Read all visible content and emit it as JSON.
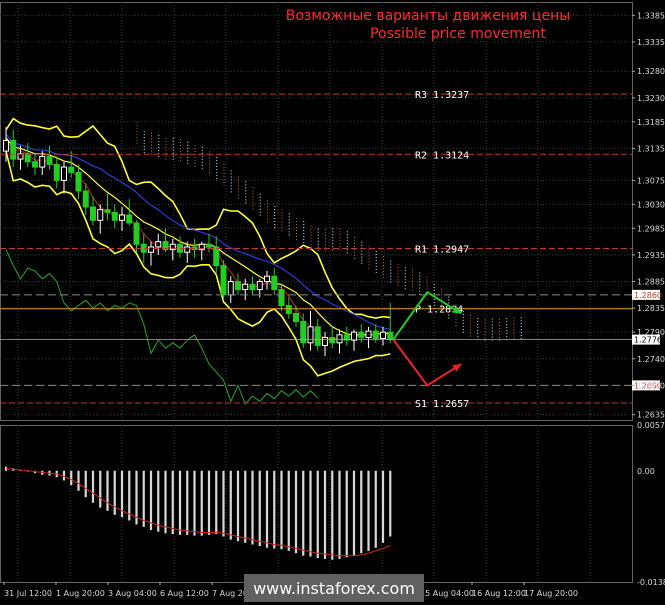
{
  "title_ru": "Возможные варианты движения цены",
  "title_en": "Possible price movement",
  "watermark": "www.instaforex.com",
  "colors": {
    "background": "#000000",
    "grid": "#3a3a3a",
    "level_line": "#c0392b",
    "pivot_line": "#d4a017",
    "bollinger": "#ffff33",
    "candles_up": "#ffffff",
    "candles_down": "#22cc22",
    "kijun": "#3344ff",
    "tenkan": "#cc2222",
    "chikou": "#22aa22",
    "cloud_a": "#f0f0f0",
    "cloud_b": "#c86a3c",
    "arrow_up": "#22cc22",
    "arrow_down": "#ee2222",
    "macd_hist": "#d8d8d8",
    "macd_signal": "#cc2222"
  },
  "chart_data": [
    {
      "type": "candlestick",
      "pair": "",
      "title": "Возможные варианты движения цены / Possible price movement",
      "y_ticks": [
        "1.3385",
        "1.3335",
        "1.3280",
        "1.3230",
        "1.3185",
        "1.3135",
        "1.3075",
        "1.3030",
        "1.2985",
        "1.2935",
        "1.2885",
        "1.2835",
        "1.2790",
        "1.2740",
        "1.2690",
        "1.2635"
      ],
      "ylim": [
        1.2625,
        1.341
      ],
      "x_ticks": [
        "31 Jul 12:00",
        "1 Aug 20:00",
        "3 Aug 04:00",
        "6 Aug 12:00",
        "7 Aug 20:00",
        "9 Aug 04:00",
        "10 Aug 12:00",
        "13 Aug 20:00",
        "15 Aug 04:00",
        "16 Aug 12:00",
        "17 Aug 20:00"
      ],
      "levels": [
        {
          "label": "R3",
          "value": 1.3237,
          "text": "R3 1.3237"
        },
        {
          "label": "R2",
          "value": 1.3124,
          "text": "R2 1.3124"
        },
        {
          "label": "R1",
          "value": 1.2947,
          "text": "R1 1.2947"
        },
        {
          "label": "P",
          "value": 1.2834,
          "text": "P 1.2834"
        },
        {
          "label": "S1",
          "value": 1.2657,
          "text": "S1 1.2657"
        }
      ],
      "price_tags": [
        {
          "value": 1.286,
          "text": "1.2860",
          "style": "box"
        },
        {
          "value": 1.2776,
          "text": "1.2776",
          "style": "current"
        },
        {
          "value": 1.269,
          "text": "1.2690",
          "style": "box"
        }
      ],
      "candles": [
        {
          "o": 1.313,
          "h": 1.3175,
          "l": 1.311,
          "c": 1.315
        },
        {
          "o": 1.315,
          "h": 1.317,
          "l": 1.31,
          "c": 1.3115
        },
        {
          "o": 1.3115,
          "h": 1.314,
          "l": 1.3095,
          "c": 1.3125
        },
        {
          "o": 1.3125,
          "h": 1.3145,
          "l": 1.31,
          "c": 1.311
        },
        {
          "o": 1.311,
          "h": 1.3125,
          "l": 1.3085,
          "c": 1.31
        },
        {
          "o": 1.31,
          "h": 1.313,
          "l": 1.3085,
          "c": 1.312
        },
        {
          "o": 1.312,
          "h": 1.314,
          "l": 1.3095,
          "c": 1.3105
        },
        {
          "o": 1.3105,
          "h": 1.312,
          "l": 1.306,
          "c": 1.3075
        },
        {
          "o": 1.3075,
          "h": 1.311,
          "l": 1.305,
          "c": 1.31
        },
        {
          "o": 1.31,
          "h": 1.313,
          "l": 1.308,
          "c": 1.309
        },
        {
          "o": 1.309,
          "h": 1.3105,
          "l": 1.304,
          "c": 1.3055
        },
        {
          "o": 1.3055,
          "h": 1.307,
          "l": 1.301,
          "c": 1.3025
        },
        {
          "o": 1.3025,
          "h": 1.3045,
          "l": 1.299,
          "c": 1.3
        },
        {
          "o": 1.3,
          "h": 1.303,
          "l": 1.2975,
          "c": 1.302
        },
        {
          "o": 1.302,
          "h": 1.305,
          "l": 1.3,
          "c": 1.3015
        },
        {
          "o": 1.3015,
          "h": 1.303,
          "l": 1.2985,
          "c": 1.3
        },
        {
          "o": 1.3,
          "h": 1.3025,
          "l": 1.298,
          "c": 1.301
        },
        {
          "o": 1.301,
          "h": 1.304,
          "l": 1.299,
          "c": 1.2995
        },
        {
          "o": 1.2995,
          "h": 1.3,
          "l": 1.294,
          "c": 1.2955
        },
        {
          "o": 1.2955,
          "h": 1.2975,
          "l": 1.292,
          "c": 1.294
        },
        {
          "o": 1.294,
          "h": 1.296,
          "l": 1.2915,
          "c": 1.295
        },
        {
          "o": 1.295,
          "h": 1.2975,
          "l": 1.2935,
          "c": 1.296
        },
        {
          "o": 1.296,
          "h": 1.2985,
          "l": 1.294,
          "c": 1.2945
        },
        {
          "o": 1.2945,
          "h": 1.2965,
          "l": 1.2925,
          "c": 1.2955
        },
        {
          "o": 1.2955,
          "h": 1.297,
          "l": 1.293,
          "c": 1.294
        },
        {
          "o": 1.294,
          "h": 1.296,
          "l": 1.292,
          "c": 1.295
        },
        {
          "o": 1.295,
          "h": 1.2965,
          "l": 1.293,
          "c": 1.2945
        },
        {
          "o": 1.2945,
          "h": 1.296,
          "l": 1.2925,
          "c": 1.2955
        },
        {
          "o": 1.2955,
          "h": 1.2975,
          "l": 1.294,
          "c": 1.295
        },
        {
          "o": 1.295,
          "h": 1.297,
          "l": 1.29,
          "c": 1.2915
        },
        {
          "o": 1.2915,
          "h": 1.2925,
          "l": 1.285,
          "c": 1.286
        },
        {
          "o": 1.286,
          "h": 1.2895,
          "l": 1.2845,
          "c": 1.2885
        },
        {
          "o": 1.2885,
          "h": 1.29,
          "l": 1.286,
          "c": 1.287
        },
        {
          "o": 1.287,
          "h": 1.289,
          "l": 1.285,
          "c": 1.288
        },
        {
          "o": 1.288,
          "h": 1.2895,
          "l": 1.286,
          "c": 1.287
        },
        {
          "o": 1.287,
          "h": 1.289,
          "l": 1.2855,
          "c": 1.2885
        },
        {
          "o": 1.2885,
          "h": 1.2905,
          "l": 1.287,
          "c": 1.2895
        },
        {
          "o": 1.2895,
          "h": 1.291,
          "l": 1.286,
          "c": 1.287
        },
        {
          "o": 1.287,
          "h": 1.288,
          "l": 1.283,
          "c": 1.284
        },
        {
          "o": 1.284,
          "h": 1.2855,
          "l": 1.2815,
          "c": 1.2825
        },
        {
          "o": 1.2825,
          "h": 1.284,
          "l": 1.28,
          "c": 1.281
        },
        {
          "o": 1.281,
          "h": 1.2825,
          "l": 1.276,
          "c": 1.277
        },
        {
          "o": 1.277,
          "h": 1.283,
          "l": 1.2755,
          "c": 1.28
        },
        {
          "o": 1.28,
          "h": 1.2815,
          "l": 1.2755,
          "c": 1.2765
        },
        {
          "o": 1.2765,
          "h": 1.279,
          "l": 1.2745,
          "c": 1.278
        },
        {
          "o": 1.278,
          "h": 1.28,
          "l": 1.276,
          "c": 1.277
        },
        {
          "o": 1.277,
          "h": 1.2795,
          "l": 1.275,
          "c": 1.2785
        },
        {
          "o": 1.2785,
          "h": 1.28,
          "l": 1.2765,
          "c": 1.2775
        },
        {
          "o": 1.2775,
          "h": 1.2795,
          "l": 1.2755,
          "c": 1.279
        },
        {
          "o": 1.279,
          "h": 1.2805,
          "l": 1.277,
          "c": 1.278
        },
        {
          "o": 1.278,
          "h": 1.28,
          "l": 1.276,
          "c": 1.2792
        },
        {
          "o": 1.2792,
          "h": 1.2805,
          "l": 1.277,
          "c": 1.2778
        },
        {
          "o": 1.2778,
          "h": 1.28,
          "l": 1.2765,
          "c": 1.279
        },
        {
          "o": 1.279,
          "h": 1.2845,
          "l": 1.277,
          "c": 1.2776
        }
      ],
      "scenarios": [
        {
          "name": "up",
          "color": "#22cc22",
          "points": [
            [
              0,
              1.2776
            ],
            [
              1,
              1.2865
            ],
            [
              2,
              1.2825
            ]
          ]
        },
        {
          "name": "down",
          "color": "#ee2222",
          "points": [
            [
              0,
              1.2776
            ],
            [
              1,
              1.269
            ],
            [
              2,
              1.273
            ]
          ]
        }
      ]
    },
    {
      "type": "histogram",
      "indicator": "",
      "y_ticks": [
        "0.00571",
        "0.00",
        "-0.01388"
      ],
      "ylim": [
        -0.01388,
        0.00571
      ],
      "values": [
        0.0005,
        0.0003,
        0.0001,
        -0.0001,
        -0.0003,
        -0.0005,
        -0.0006,
        -0.0008,
        -0.0012,
        -0.0018,
        -0.0025,
        -0.0033,
        -0.004,
        -0.0046,
        -0.005,
        -0.0055,
        -0.0058,
        -0.0062,
        -0.0067,
        -0.007,
        -0.0074,
        -0.0076,
        -0.0078,
        -0.0079,
        -0.008,
        -0.008,
        -0.0081,
        -0.0081,
        -0.008,
        -0.0079,
        -0.0082,
        -0.0086,
        -0.0088,
        -0.009,
        -0.0092,
        -0.0094,
        -0.0096,
        -0.0097,
        -0.0098,
        -0.01,
        -0.0103,
        -0.0106,
        -0.0107,
        -0.0109,
        -0.011,
        -0.0111,
        -0.011,
        -0.0108,
        -0.0106,
        -0.0103,
        -0.01,
        -0.0096,
        -0.009,
        -0.0082
      ],
      "signal": [
        0.0003,
        0.0002,
        0.0001,
        0.0,
        -0.0001,
        -0.0002,
        -0.0003,
        -0.0004,
        -0.0007,
        -0.0011,
        -0.0016,
        -0.0022,
        -0.0028,
        -0.0034,
        -0.004,
        -0.0045,
        -0.005,
        -0.0054,
        -0.0058,
        -0.0062,
        -0.0065,
        -0.0068,
        -0.007,
        -0.0072,
        -0.0074,
        -0.0075,
        -0.0076,
        -0.0077,
        -0.0077,
        -0.0077,
        -0.0078,
        -0.008,
        -0.0082,
        -0.0084,
        -0.0086,
        -0.0088,
        -0.009,
        -0.0092,
        -0.0093,
        -0.0095,
        -0.0097,
        -0.0099,
        -0.0101,
        -0.0103,
        -0.0104,
        -0.0105,
        -0.0106,
        -0.0106,
        -0.0106,
        -0.0105,
        -0.0103,
        -0.01,
        -0.0097,
        -0.0093
      ]
    }
  ]
}
